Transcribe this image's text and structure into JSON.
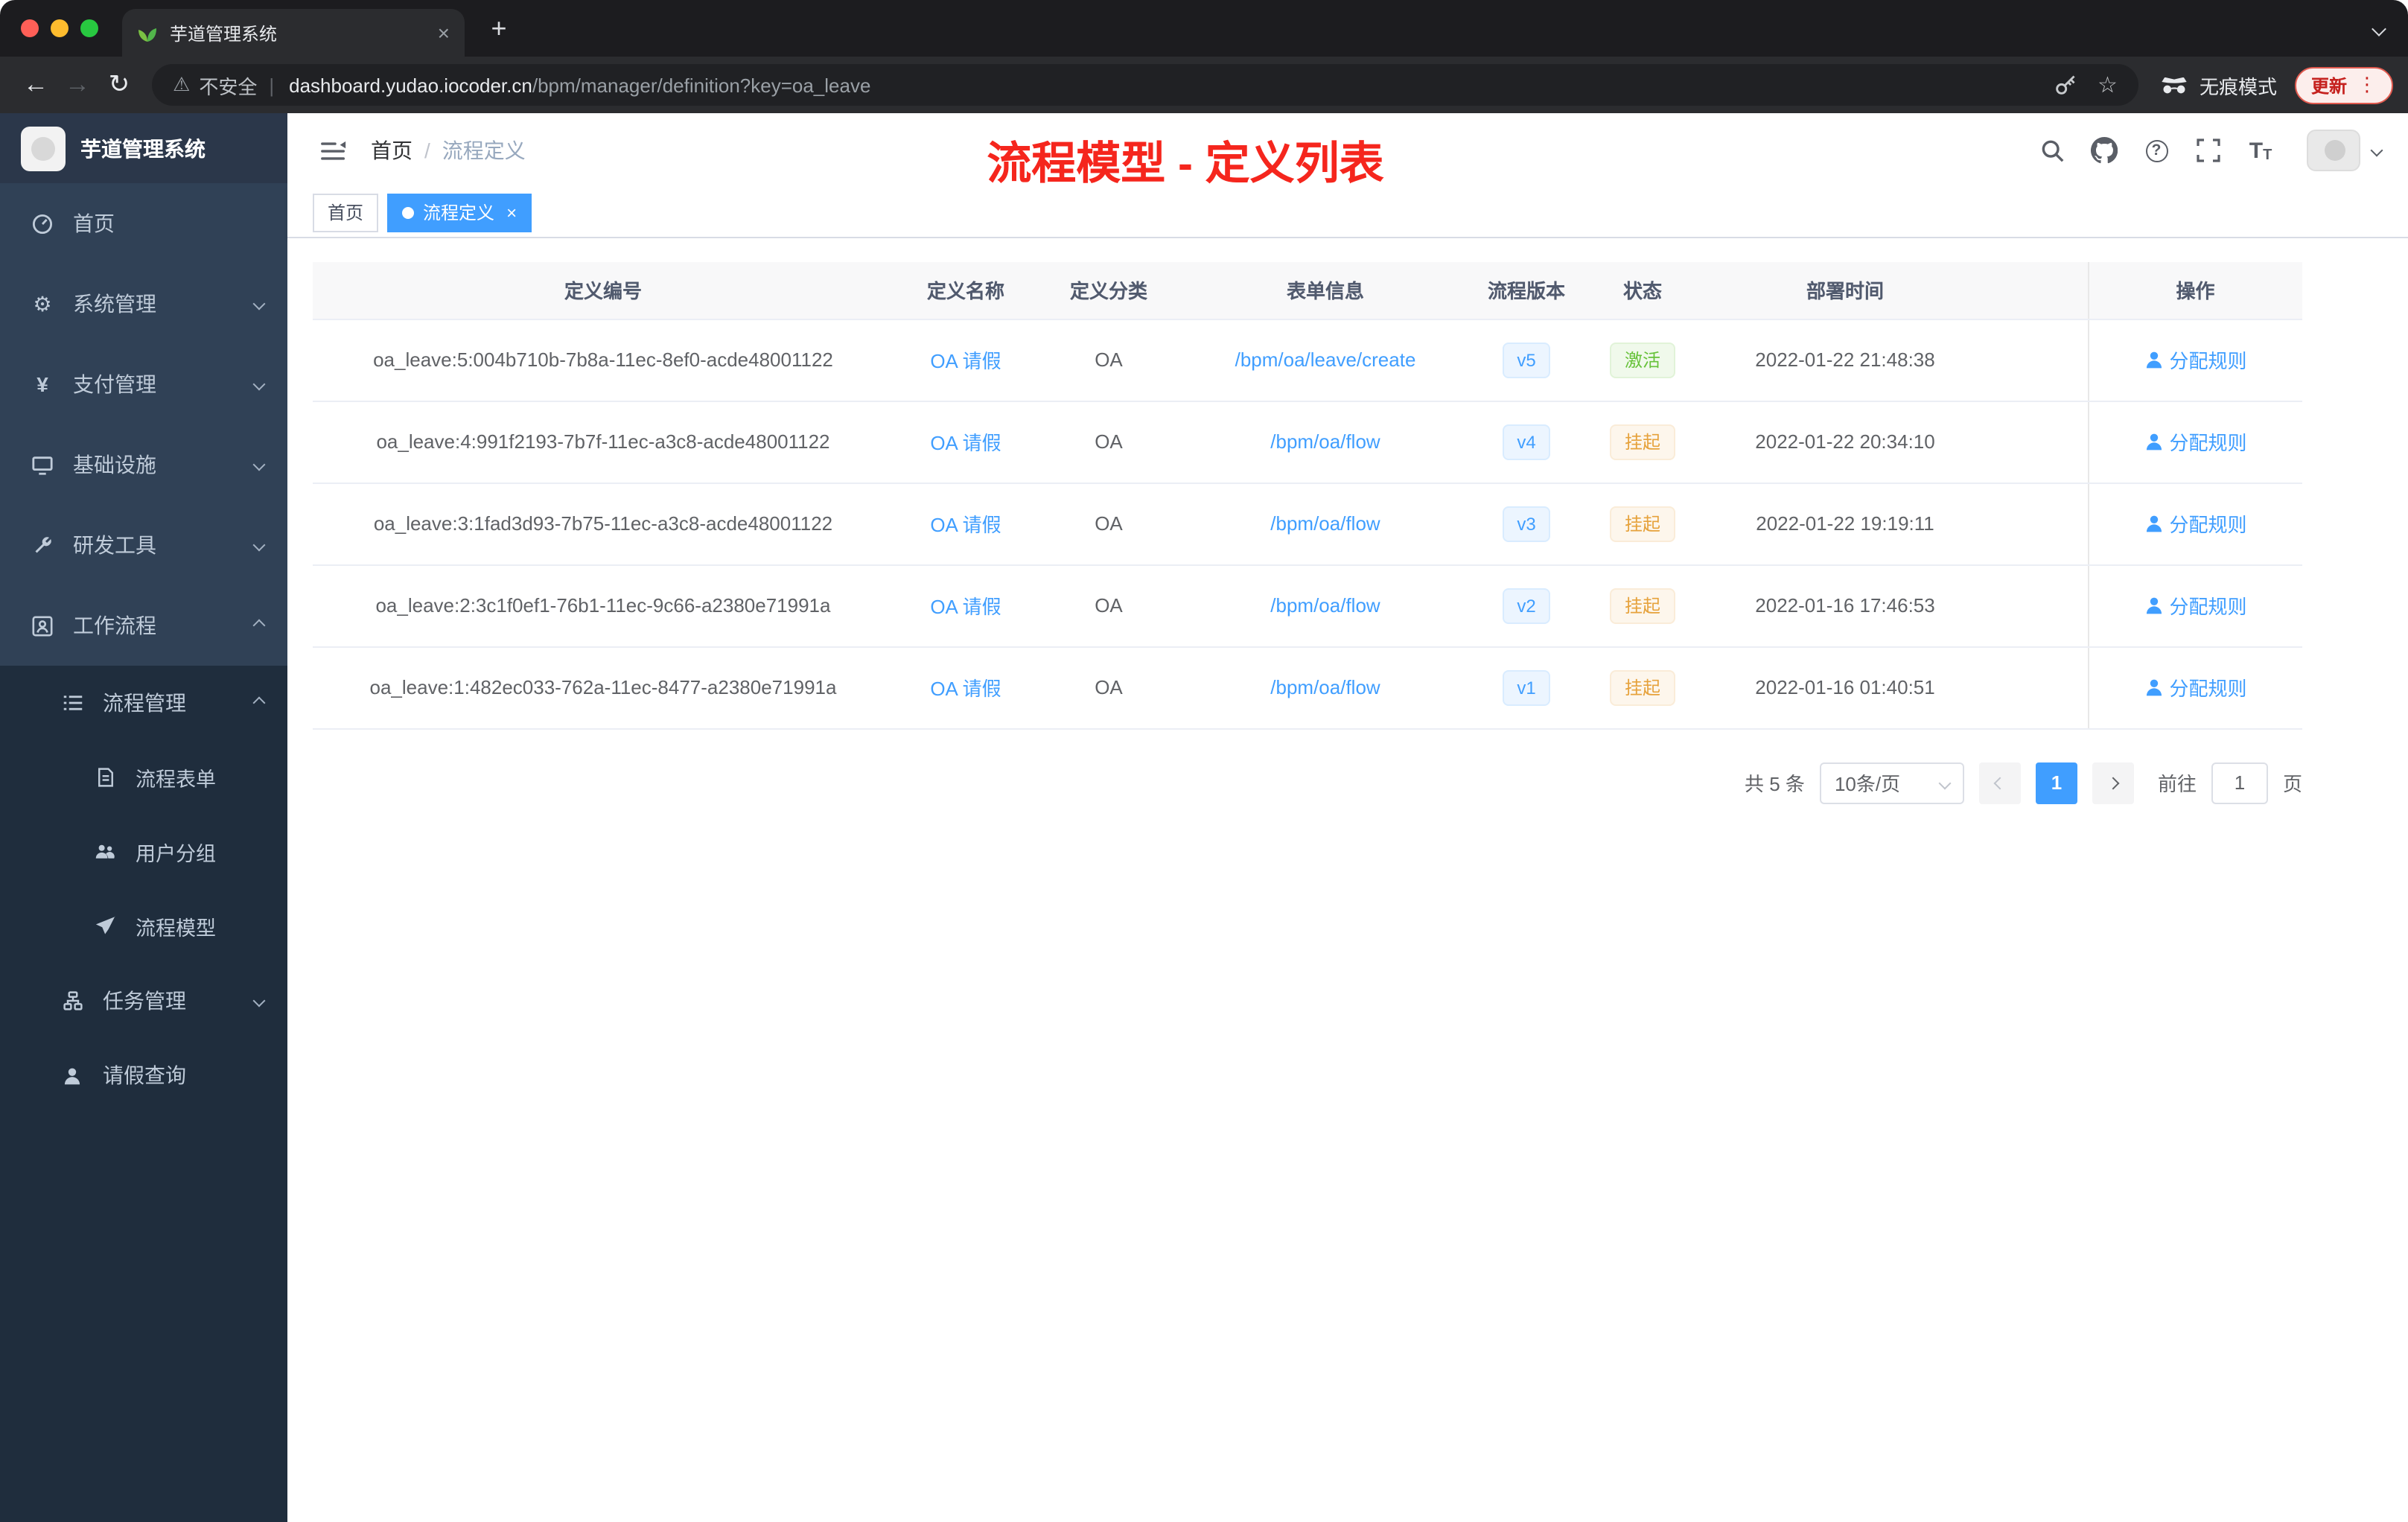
{
  "browser": {
    "tab": {
      "title": "芋道管理系统"
    },
    "security_label": "不安全",
    "url_domain": "dashboard.yudao.iocoder.cn",
    "url_path": "/bpm/manager/definition?key=oa_leave",
    "incognito_label": "无痕模式",
    "update_label": "更新"
  },
  "sidebar": {
    "title": "芋道管理系统",
    "items": [
      {
        "label": "首页"
      },
      {
        "label": "系统管理"
      },
      {
        "label": "支付管理"
      },
      {
        "label": "基础设施"
      },
      {
        "label": "研发工具"
      },
      {
        "label": "工作流程"
      },
      {
        "label": "流程管理"
      },
      {
        "label": "流程表单"
      },
      {
        "label": "用户分组"
      },
      {
        "label": "流程模型"
      },
      {
        "label": "任务管理"
      },
      {
        "label": "请假查询"
      }
    ]
  },
  "header": {
    "breadcrumb_home": "首页",
    "breadcrumb_sep": "/",
    "breadcrumb_current": "流程定义",
    "annotation": "流程模型 - 定义列表"
  },
  "tags": {
    "home": "首页",
    "active": "流程定义"
  },
  "table": {
    "columns": [
      "定义编号",
      "定义名称",
      "定义分类",
      "表单信息",
      "流程版本",
      "状态",
      "部署时间",
      "操作"
    ],
    "action_label": "分配规则",
    "rows": [
      {
        "id": "oa_leave:5:004b710b-7b8a-11ec-8ef0-acde48001122",
        "name": "OA 请假",
        "category": "OA",
        "form": "/bpm/oa/leave/create",
        "version": "v5",
        "status": "激活",
        "time": "2022-01-22 21:48:38"
      },
      {
        "id": "oa_leave:4:991f2193-7b7f-11ec-a3c8-acde48001122",
        "name": "OA 请假",
        "category": "OA",
        "form": "/bpm/oa/flow",
        "version": "v4",
        "status": "挂起",
        "time": "2022-01-22 20:34:10"
      },
      {
        "id": "oa_leave:3:1fad3d93-7b75-11ec-a3c8-acde48001122",
        "name": "OA 请假",
        "category": "OA",
        "form": "/bpm/oa/flow",
        "version": "v3",
        "status": "挂起",
        "time": "2022-01-22 19:19:11"
      },
      {
        "id": "oa_leave:2:3c1f0ef1-76b1-11ec-9c66-a2380e71991a",
        "name": "OA 请假",
        "category": "OA",
        "form": "/bpm/oa/flow",
        "version": "v2",
        "status": "挂起",
        "time": "2022-01-16 17:46:53"
      },
      {
        "id": "oa_leave:1:482ec033-762a-11ec-8477-a2380e71991a",
        "name": "OA 请假",
        "category": "OA",
        "form": "/bpm/oa/flow",
        "version": "v1",
        "status": "挂起",
        "time": "2022-01-16 01:40:51"
      }
    ]
  },
  "pagination": {
    "total": "共 5 条",
    "page_size": "10条/页",
    "current_page": "1",
    "goto_label": "前往",
    "goto_value": "1",
    "page_label": "页"
  },
  "colors": {
    "primary": "#409eff",
    "status_active": "#67c23a",
    "status_suspended": "#e6a23c",
    "annotation_red": "#f5261d",
    "sidebar_bg": "#304156",
    "submenu_bg": "#1f2d3d"
  }
}
